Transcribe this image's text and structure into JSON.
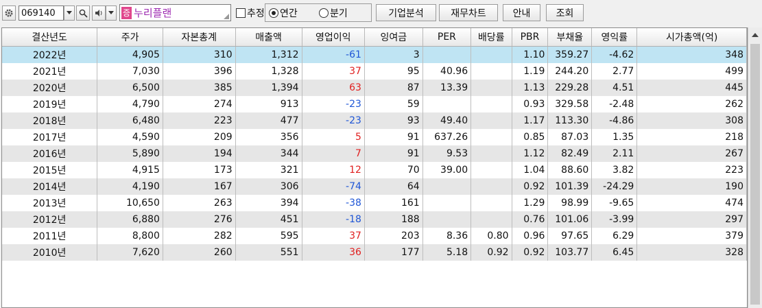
{
  "toolbar": {
    "stock_code": "069140",
    "badge": "증",
    "stock_name": "누리플랜",
    "estimate_label": "추정",
    "annual_label": "연간",
    "quarter_label": "분기",
    "company_analysis": "기업분석",
    "financial_chart": "재무차트",
    "guide": "안내",
    "query": "조회",
    "annual_selected": true
  },
  "table": {
    "headers": [
      "결산년도",
      "주가",
      "자본총계",
      "매출액",
      "영업이익",
      "잉여금",
      "PER",
      "배당률",
      "PBR",
      "부채율",
      "영익률",
      "시가총액(억)"
    ],
    "rows": [
      [
        "2022년",
        "4,905",
        "310",
        "1,312",
        "-61",
        "3",
        "",
        "",
        "1.10",
        "359.27",
        "-4.62",
        "348"
      ],
      [
        "2021년",
        "7,030",
        "396",
        "1,328",
        "37",
        "95",
        "40.96",
        "",
        "1.19",
        "244.20",
        "2.77",
        "499"
      ],
      [
        "2020년",
        "6,500",
        "385",
        "1,394",
        "63",
        "87",
        "13.39",
        "",
        "1.13",
        "229.28",
        "4.51",
        "445"
      ],
      [
        "2019년",
        "4,790",
        "274",
        "913",
        "-23",
        "59",
        "",
        "",
        "0.93",
        "329.58",
        "-2.48",
        "262"
      ],
      [
        "2018년",
        "6,480",
        "223",
        "477",
        "-23",
        "93",
        "49.40",
        "",
        "1.17",
        "113.30",
        "-4.86",
        "308"
      ],
      [
        "2017년",
        "4,590",
        "209",
        "356",
        "5",
        "91",
        "637.26",
        "",
        "0.85",
        "87.03",
        "1.35",
        "218"
      ],
      [
        "2016년",
        "5,890",
        "194",
        "344",
        "7",
        "91",
        "9.53",
        "",
        "1.12",
        "82.49",
        "2.11",
        "267"
      ],
      [
        "2015년",
        "4,915",
        "173",
        "321",
        "12",
        "70",
        "39.00",
        "",
        "1.04",
        "88.60",
        "3.82",
        "223"
      ],
      [
        "2014년",
        "4,190",
        "167",
        "306",
        "-74",
        "64",
        "",
        "",
        "0.92",
        "101.39",
        "-24.29",
        "190"
      ],
      [
        "2013년",
        "10,650",
        "263",
        "394",
        "-38",
        "161",
        "",
        "",
        "1.29",
        "98.99",
        "-9.65",
        "474"
      ],
      [
        "2012년",
        "6,880",
        "276",
        "451",
        "-18",
        "188",
        "",
        "",
        "0.76",
        "101.06",
        "-3.99",
        "297"
      ],
      [
        "2011년",
        "8,800",
        "282",
        "595",
        "37",
        "203",
        "8.36",
        "0.80",
        "0.96",
        "97.65",
        "6.29",
        "379"
      ],
      [
        "2010년",
        "7,620",
        "260",
        "551",
        "36",
        "177",
        "5.18",
        "0.92",
        "0.92",
        "103.77",
        "6.45",
        "328"
      ]
    ]
  },
  "colors": {
    "negative": "#1f56d6",
    "positive": "#e02020",
    "selected_row": "#bfe4f3",
    "badge": "#e0468c",
    "stock_name": "#9c27b0"
  },
  "icons": [
    "gear-icon",
    "dropdown-arrow-icon",
    "search-icon",
    "speaker-icon",
    "resize-grip-icon",
    "scroll-up-icon"
  ]
}
